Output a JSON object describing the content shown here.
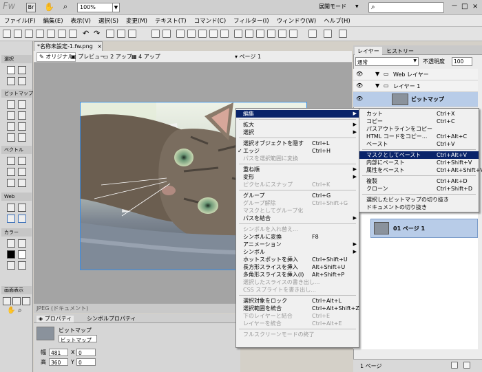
{
  "app": {
    "logo": "Fw",
    "zoom": "100%",
    "mode": "展開モード",
    "win_min": "－",
    "win_max": "□",
    "win_close": "×"
  },
  "menubar": [
    "ファイル(F)",
    "編集(E)",
    "表示(V)",
    "選択(S)",
    "変更(M)",
    "テキスト(T)",
    "コマンド(C)",
    "フィルター(I)",
    "ウィンドウ(W)",
    "ヘルプ(H)"
  ],
  "document": {
    "tab": "*名称未設定-1.fw.png",
    "close": "×",
    "views": [
      "オリジナル",
      "プレビュー",
      "2 アップ",
      "4 アップ"
    ],
    "page": "ページ 1",
    "status": "JPEG (ドキュメント)"
  },
  "tools": {
    "sections": [
      "選択",
      "ビットマップ",
      "ベクトル",
      "Web",
      "カラー",
      "画面表示"
    ]
  },
  "properties": {
    "tabs": [
      "プロパティ",
      "シンボルプロパティ"
    ],
    "title": "ビットマップ",
    "name": "ビットマップ",
    "w_label": "幅",
    "w": "481",
    "h_label": "高",
    "h": "360",
    "x_label": "X",
    "x": "0",
    "y_label": "Y",
    "y": "0"
  },
  "right_panel": {
    "tabs": [
      "レイヤー",
      "ヒストリー"
    ],
    "blend": "通常",
    "opacity_label": "不透明度",
    "opacity": "100",
    "layers": [
      "Web レイヤー",
      "レイヤー 1",
      "ビットマップ"
    ],
    "page_item": "01 ページ 1",
    "footer": "1 ページ"
  },
  "context_menu": [
    {
      "label": "編集",
      "arrow": true,
      "sel": true
    },
    {
      "sep": true
    },
    {
      "label": "拡大",
      "arrow": true
    },
    {
      "label": "選択",
      "arrow": true
    },
    {
      "sep": true
    },
    {
      "label": "選択オブジェクトを隠す",
      "shortcut": "Ctrl+L"
    },
    {
      "label": "エッジ",
      "shortcut": "Ctrl+H",
      "check": true
    },
    {
      "label": "パスを選択範囲に変換",
      "dis": true
    },
    {
      "sep": true
    },
    {
      "label": "重ね順",
      "arrow": true
    },
    {
      "label": "変形",
      "arrow": true
    },
    {
      "label": "ピクセルにスナップ",
      "shortcut": "Ctrl+K",
      "dis": true
    },
    {
      "sep": true
    },
    {
      "label": "グループ",
      "shortcut": "Ctrl+G"
    },
    {
      "label": "グループ解除",
      "shortcut": "Ctrl+Shift+G",
      "dis": true
    },
    {
      "label": "マスクとしてグループ化",
      "dis": true
    },
    {
      "label": "パスを結合",
      "arrow": true
    },
    {
      "sep": true
    },
    {
      "label": "シンボルを入れ替え...",
      "dis": true
    },
    {
      "label": "シンボルに変換",
      "shortcut": "F8"
    },
    {
      "label": "アニメーション",
      "arrow": true
    },
    {
      "label": "シンボル",
      "arrow": true
    },
    {
      "label": "ホットスポットを挿入",
      "shortcut": "Ctrl+Shift+U"
    },
    {
      "label": "長方形スライスを挿入",
      "shortcut": "Alt+Shift+U"
    },
    {
      "label": "多角形スライスを挿入(I)",
      "shortcut": "Alt+Shift+P"
    },
    {
      "label": "選択したスライスの書き出し...",
      "dis": true
    },
    {
      "label": "CSS スプライトを書き出し...",
      "dis": true
    },
    {
      "sep": true
    },
    {
      "label": "選択対象をロック",
      "shortcut": "Ctrl+Alt+L"
    },
    {
      "label": "選択範囲を統合",
      "shortcut": "Ctrl+Alt+Shift+Z"
    },
    {
      "label": "下のレイヤーと結合",
      "shortcut": "Ctrl+E",
      "dis": true
    },
    {
      "label": "レイヤーを統合",
      "shortcut": "Ctrl+Alt+E",
      "dis": true
    },
    {
      "sep": true
    },
    {
      "label": "フルスクリーンモードの終了",
      "dis": true
    }
  ],
  "submenu": [
    {
      "label": "カット",
      "shortcut": "Ctrl+X"
    },
    {
      "label": "コピー",
      "shortcut": "Ctrl+C"
    },
    {
      "label": "パスアウトラインをコピー"
    },
    {
      "label": "HTML コードをコピー...",
      "shortcut": "Ctrl+Alt+C"
    },
    {
      "label": "ペースト",
      "shortcut": "Ctrl+V"
    },
    {
      "sep": true
    },
    {
      "label": "マスクとしてペースト",
      "shortcut": "Ctrl+Alt+V",
      "sel": true
    },
    {
      "label": "内部にペースト",
      "shortcut": "Ctrl+Shift+V"
    },
    {
      "label": "属性をペースト",
      "shortcut": "Ctrl+Alt+Shift+V"
    },
    {
      "sep": true
    },
    {
      "label": "複製",
      "shortcut": "Ctrl+Alt+D"
    },
    {
      "label": "クローン",
      "shortcut": "Ctrl+Shift+D"
    },
    {
      "sep": true
    },
    {
      "label": "選択したビットマップの切り抜き"
    },
    {
      "label": "ドキュメントの切り抜き"
    }
  ]
}
